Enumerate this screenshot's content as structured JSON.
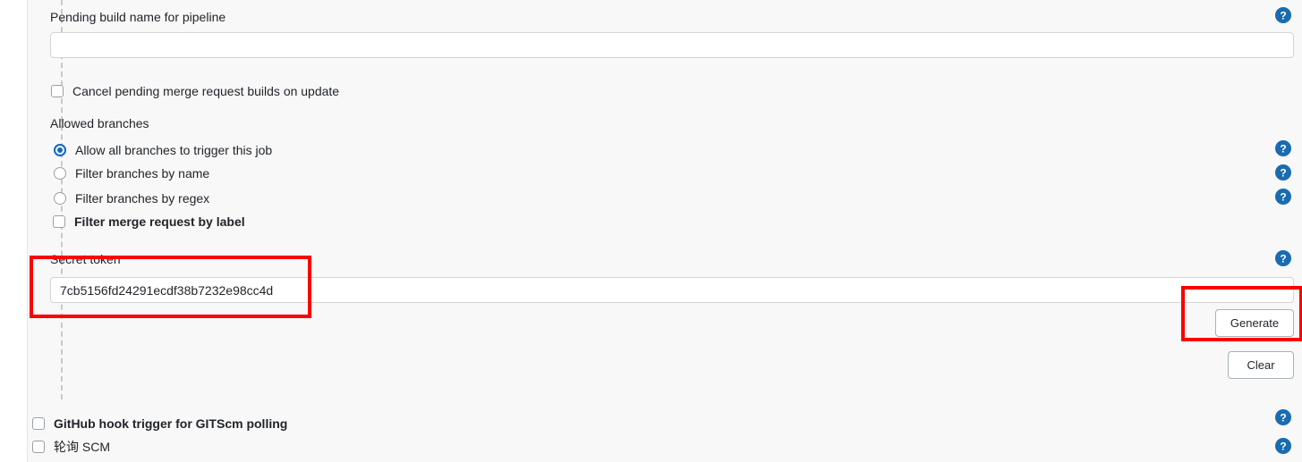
{
  "form": {
    "pending_build_name": {
      "label": "Pending build name for pipeline",
      "value": "",
      "placeholder": ""
    },
    "cancel_pending": {
      "label": "Cancel pending merge request builds on update",
      "checked": false
    },
    "allowed_branches": {
      "label": "Allowed branches",
      "options": [
        {
          "label": "Allow all branches to trigger this job",
          "selected": true
        },
        {
          "label": "Filter branches by name",
          "selected": false
        },
        {
          "label": "Filter branches by regex",
          "selected": false
        }
      ]
    },
    "filter_merge_request_by_label": {
      "label": "Filter merge request by label",
      "checked": false
    },
    "secret_token": {
      "label": "Secret token",
      "value": "7cb5156fd24291ecdf38b7232e98cc4d",
      "placeholder": ""
    },
    "buttons": {
      "generate": "Generate",
      "clear": "Clear"
    },
    "triggers": [
      {
        "label": "GitHub hook trigger for GITScm polling",
        "checked": false
      },
      {
        "label": "轮询 SCM",
        "checked": false
      }
    ]
  },
  "icons": {
    "help": "help-icon",
    "help_glyph": "?"
  },
  "colors": {
    "accent_blue": "#1268c3",
    "help_blue": "#1a6bb0",
    "annotation_red": "#fc0000",
    "pane_bg": "#f8f8f8",
    "input_border": "#d4d4d4",
    "button_border": "#a8b0b8",
    "text": "#1f2328"
  },
  "annotations": [
    {
      "name": "secret-token-highlight"
    },
    {
      "name": "generate-button-highlight"
    }
  ]
}
